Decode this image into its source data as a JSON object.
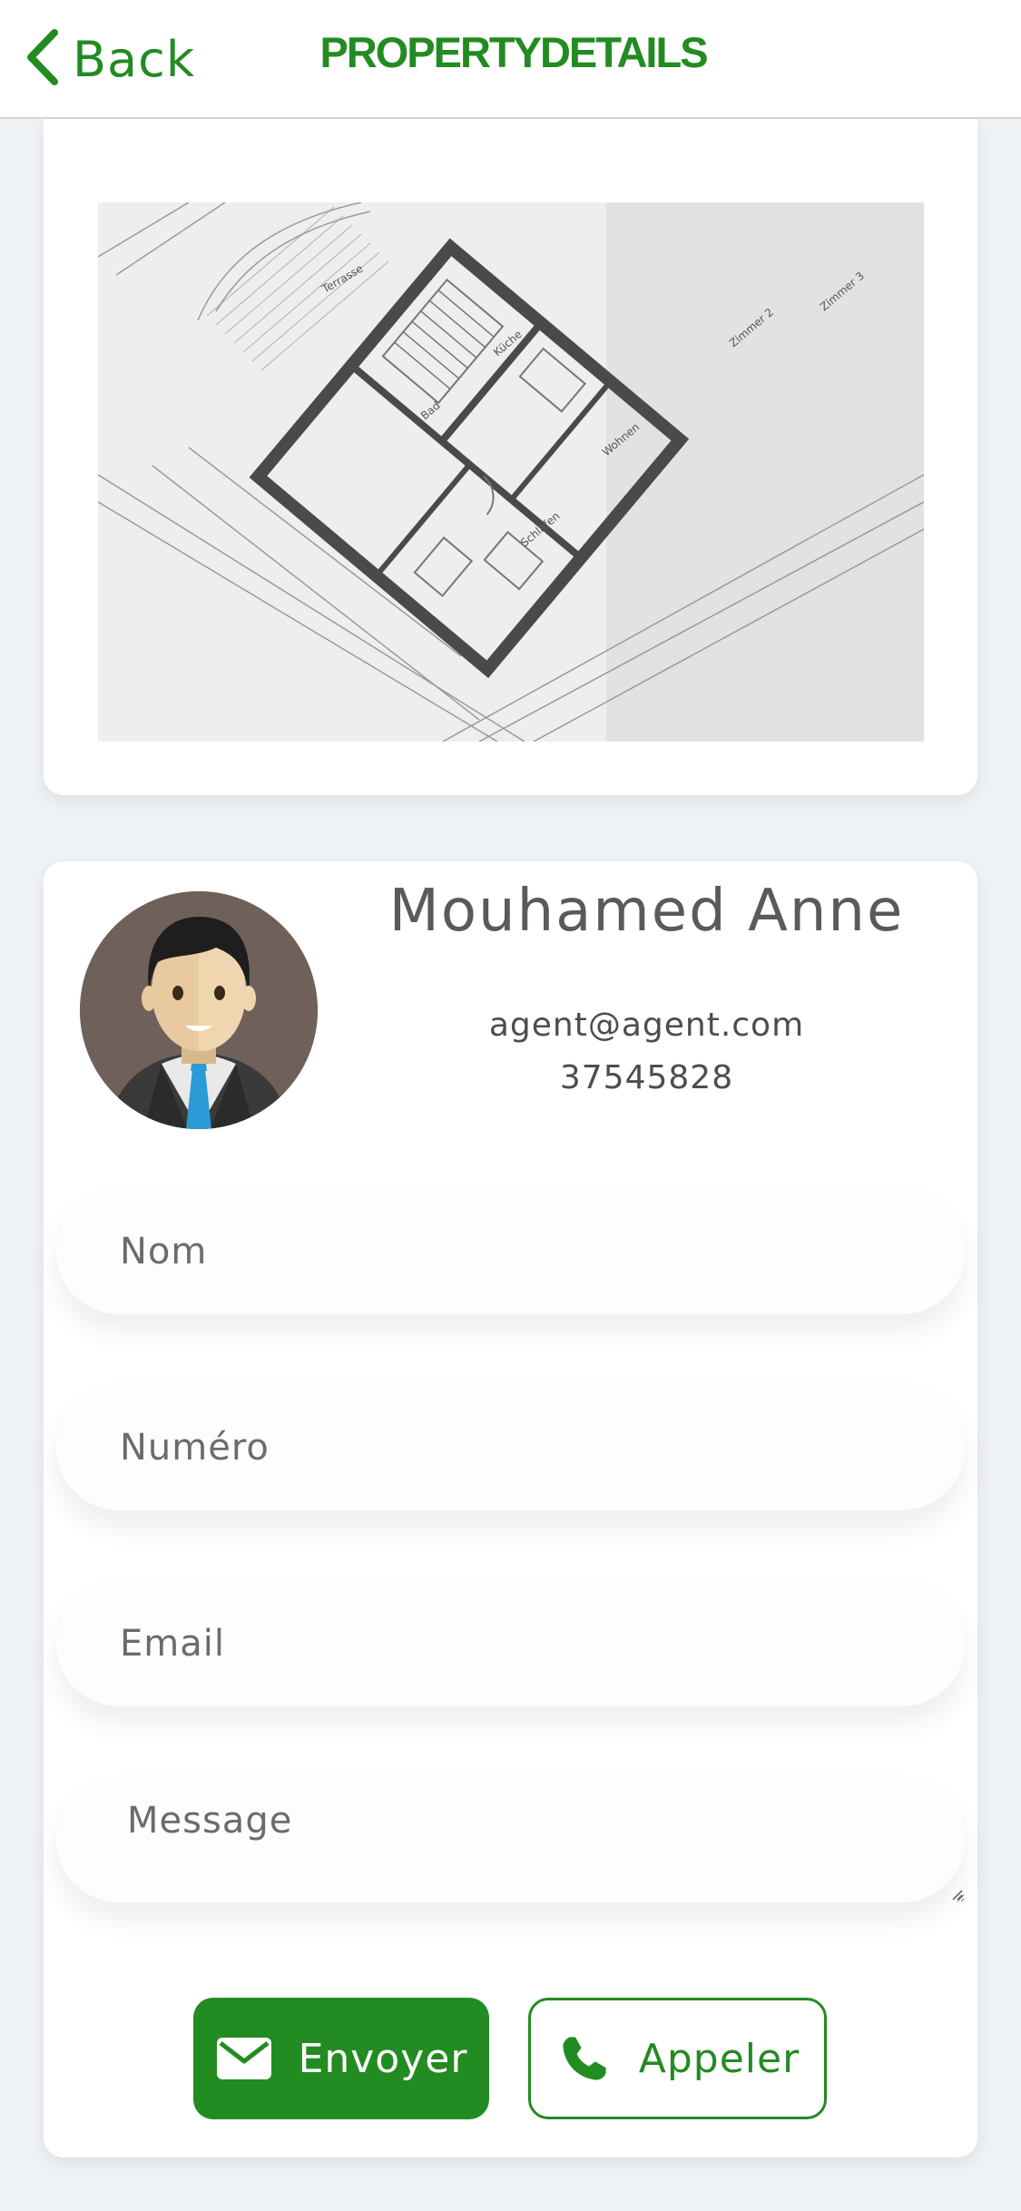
{
  "header": {
    "back_label": "Back",
    "title": "PROPERTYDETAILS"
  },
  "property": {
    "image": "floor-plan-blueprint"
  },
  "agent": {
    "name": "Mouhamed Anne",
    "email": "agent@agent.com",
    "phone": "37545828"
  },
  "form": {
    "nom_placeholder": "Nom",
    "numero_placeholder": "Numéro",
    "email_placeholder": "Email",
    "message_placeholder": "Message"
  },
  "actions": {
    "send_label": "Envoyer",
    "call_label": "Appeler"
  },
  "colors": {
    "accent": "#228b22",
    "background": "#eff2f5",
    "card": "#ffffff",
    "text": "#5a5a5a"
  },
  "icons": {
    "back": "chevron-left-icon",
    "send": "envelope-icon",
    "call": "phone-icon"
  }
}
